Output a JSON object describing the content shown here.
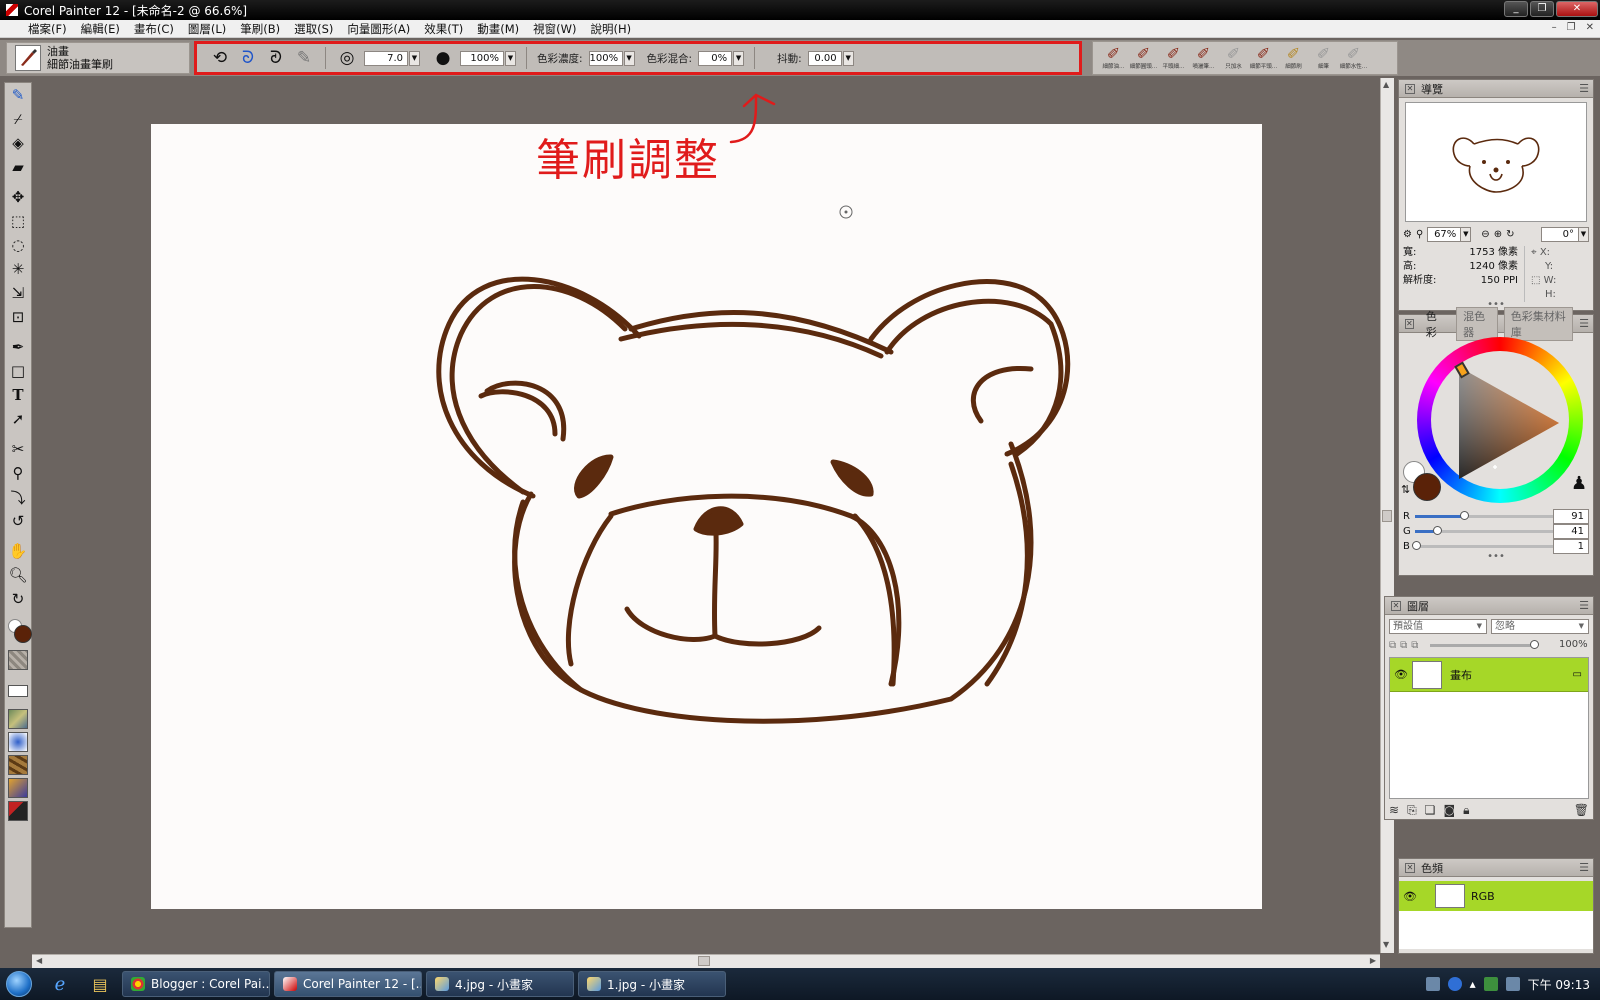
{
  "window": {
    "title": "Corel Painter 12 - [未命名-2 @ 66.6%]",
    "buttons": {
      "minimize": "_",
      "restore": "❐",
      "close": "✕"
    }
  },
  "menu": [
    "檔案(F)",
    "編輯(E)",
    "畫布(C)",
    "圖層(L)",
    "筆刷(B)",
    "選取(S)",
    "向量圖形(A)",
    "效果(T)",
    "動畫(M)",
    "視窗(W)",
    "說明(H)"
  ],
  "doc_controls": {
    "minimize": "–",
    "restore": "❐",
    "close": "✕"
  },
  "brush_selector": {
    "category": "油畫",
    "variant": "細節油畫筆刷"
  },
  "property_bar": {
    "size": "7.0",
    "opacity": "100%",
    "color_concentration_label": "色彩濃度:",
    "color_concentration": "100%",
    "color_mix_label": "色彩混合:",
    "color_mix": "0%",
    "jitter_label": "抖動:",
    "jitter": "0.00"
  },
  "brush_strip": [
    "細節油…",
    "細節圓頭…",
    "平頭細…",
    "噴灑筆…",
    "只加水",
    "細節平頭…",
    "細節刷",
    "細筆",
    "細節水性…",
    "細節木…"
  ],
  "annotation": "筆刷調整",
  "navigator": {
    "title": "導覽",
    "zoom": "67%",
    "rotation": "0°",
    "width_label": "寬:",
    "width": "1753 像素",
    "height_label": "高:",
    "height": "1240 像素",
    "resolution_label": "解析度:",
    "resolution": "150 PPI",
    "x_label": "X:",
    "y_label": "Y:",
    "w_label": "W:",
    "h_label": "H:"
  },
  "color_panel": {
    "tabs": [
      "色彩",
      "混色器",
      "色彩集材料庫"
    ],
    "main_color": "#5a2208",
    "secondary_color": "#ffffff",
    "r_label": "R",
    "r": 91,
    "g_label": "G",
    "g": 41,
    "b_label": "B",
    "b": 1
  },
  "layers_panel": {
    "title": "圖層",
    "composite_method": "預設值",
    "composite_depth": "忽略",
    "opacity": "100%",
    "layers": [
      {
        "name": "畫布"
      }
    ]
  },
  "channels_panel": {
    "title": "色頻",
    "channels": [
      {
        "name": "RGB"
      }
    ]
  },
  "taskbar": {
    "tasks": [
      {
        "label": "Blogger : Corel Pai…"
      },
      {
        "label": "Corel Painter 12 - [..."
      },
      {
        "label": "4.jpg - 小畫家"
      },
      {
        "label": "1.jpg - 小畫家"
      }
    ],
    "clock": "下午 09:13"
  },
  "colors": {
    "accent_red": "#e01b1b",
    "layer_selected": "#a6d728",
    "bear_stroke": "#5b2a0e"
  }
}
